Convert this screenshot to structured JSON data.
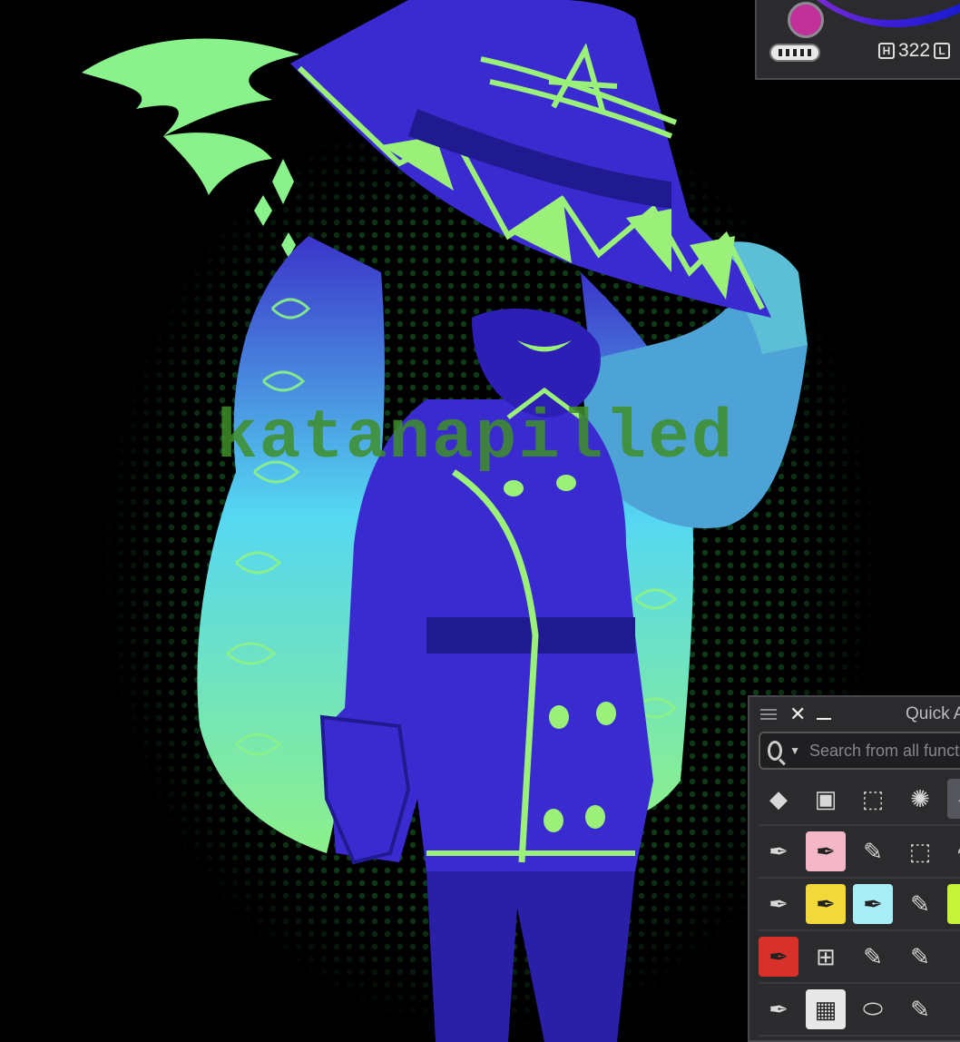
{
  "artwork": {
    "watermark_text": "katanapilled"
  },
  "color_panel": {
    "current_color": "#c2309a",
    "hue_label": "H",
    "hue_value": "322",
    "lightness_label": "L"
  },
  "quick_access": {
    "title": "Quick A",
    "search_placeholder": "Search from all functions",
    "rows": [
      [
        {
          "icon": "fill-bucket-icon"
        },
        {
          "icon": "reference-window-icon"
        },
        {
          "icon": "transform-icon"
        },
        {
          "icon": "radial-lines-icon"
        },
        {
          "icon": "operation-arrow-icon",
          "selected": true
        }
      ],
      [
        {
          "icon": "pen-icon"
        },
        {
          "icon": "pink-pen-icon"
        },
        {
          "icon": "marker-icon"
        },
        {
          "icon": "rectangle-selection-icon"
        },
        {
          "icon": "lasso-icon"
        }
      ],
      [
        {
          "icon": "g-pen-icon"
        },
        {
          "icon": "yellow-pen-icon"
        },
        {
          "icon": "cyan-pen-icon"
        },
        {
          "icon": "brush-pen-icon"
        },
        {
          "icon": "green-pen-icon"
        }
      ],
      [
        {
          "icon": "red-pen-icon"
        },
        {
          "icon": "perspective-ruler-icon"
        },
        {
          "icon": "thick-marker-icon"
        },
        {
          "icon": "round-pen-icon"
        },
        {
          "icon": "airbrush-icon"
        }
      ],
      [
        {
          "icon": "mapping-pen-icon"
        },
        {
          "icon": "screentone-thumbnail-icon"
        },
        {
          "icon": "eraser-icon"
        },
        {
          "icon": "pencil-icon"
        },
        {
          "icon": "blend-icon"
        }
      ]
    ]
  }
}
